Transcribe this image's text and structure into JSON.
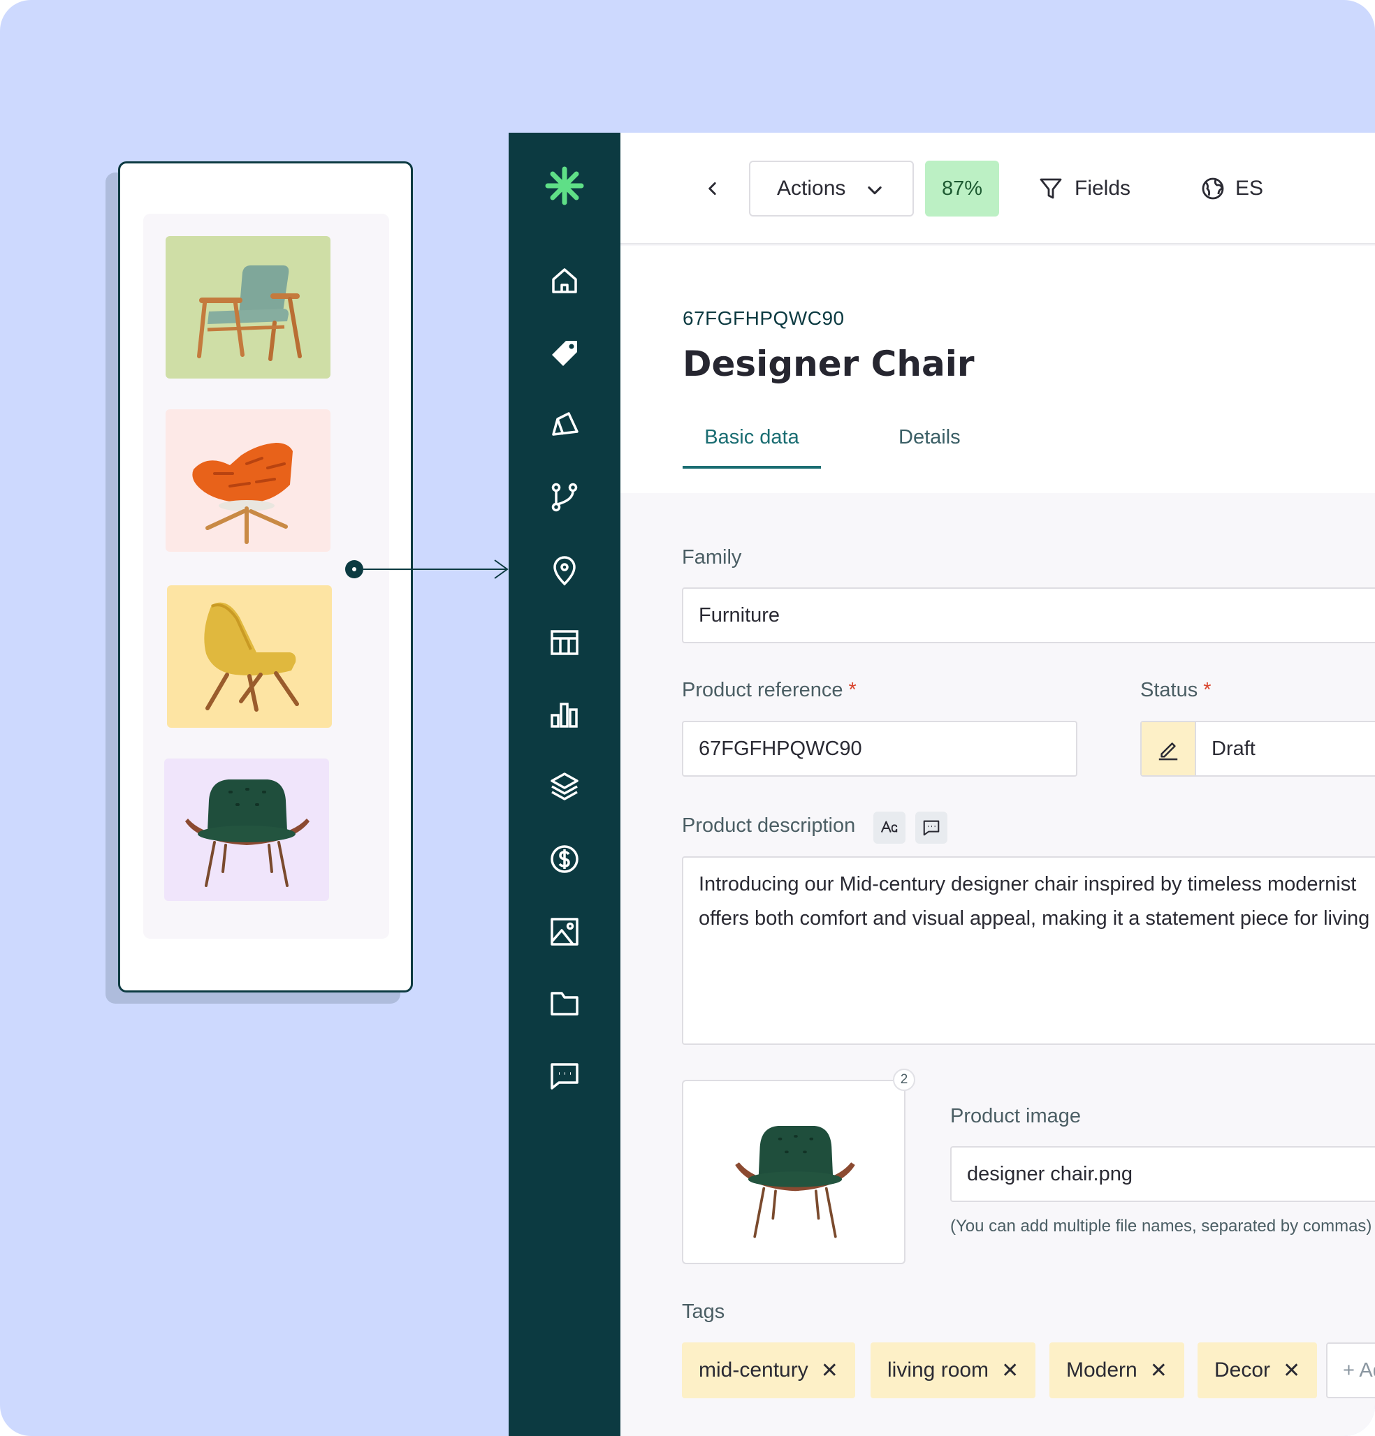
{
  "topbar": {
    "actions_label": "Actions",
    "completeness": "87%",
    "fields_label": "Fields",
    "language": "ES"
  },
  "product": {
    "sku": "67FGFHPQWC90",
    "title": "Designer Chair"
  },
  "tabs": [
    {
      "label": "Basic data",
      "active": true
    },
    {
      "label": "Details",
      "active": false
    }
  ],
  "form": {
    "family": {
      "label": "Family",
      "value": "Furniture"
    },
    "reference": {
      "label": "Product reference",
      "required_mark": "*",
      "value": "67FGFHPQWC90"
    },
    "status": {
      "label": "Status",
      "required_mark": "*",
      "value": "Draft"
    },
    "description": {
      "label": "Product description",
      "line1": "Introducing our Mid-century designer chair inspired by timeless modernist",
      "line2": "offers both comfort and visual appeal, making it a statement piece for living"
    },
    "image": {
      "count": "2",
      "label": "Product image",
      "value": "designer chair.png",
      "hint": "(You can add multiple file names, separated by commas)"
    },
    "tags": {
      "label": "Tags",
      "items": [
        "mid-century",
        "living room",
        "Modern",
        "Decor"
      ],
      "remove_glyph": "✕",
      "add_label": "+ Add"
    }
  },
  "sidebar": {
    "icons": [
      "home-icon",
      "tag-icon",
      "brand-icon",
      "branch-icon",
      "location-icon",
      "grid-icon",
      "chart-icon",
      "layers-icon",
      "dollar-icon",
      "image-icon",
      "folder-icon",
      "chat-icon"
    ]
  },
  "colors": {
    "sidebar": "#0c3a41",
    "accent": "#1a6d72",
    "logo": "#5fdf87",
    "completeness_bg": "#bcf0c4",
    "tag_bg": "#fdf0c7",
    "background": "#cdd9fe"
  }
}
